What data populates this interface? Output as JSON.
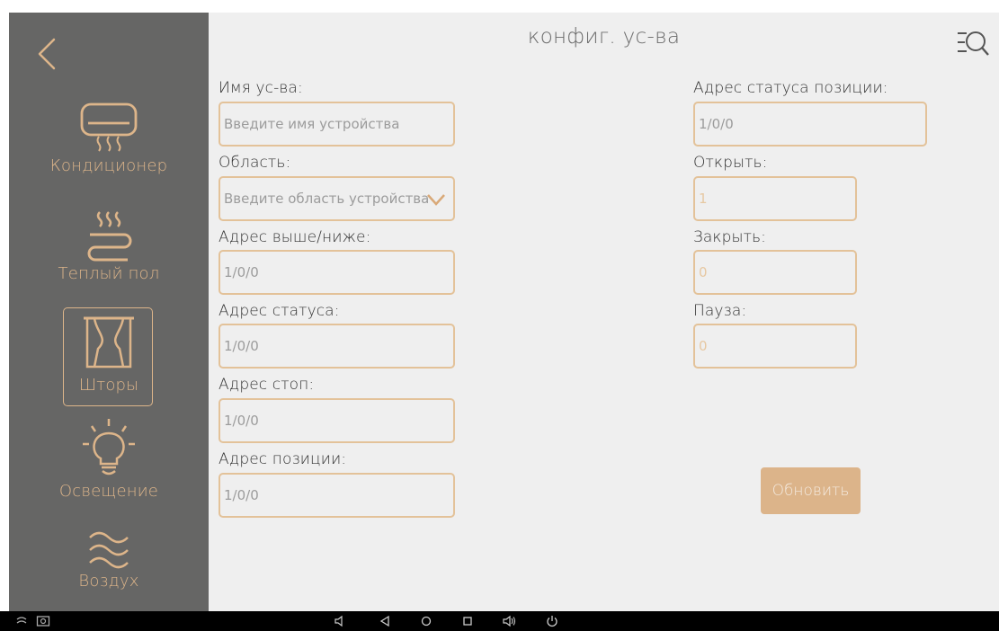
{
  "header": {
    "title": "конфиг. ус-ва"
  },
  "sidebar": {
    "items": [
      {
        "label": "Кондиционер",
        "icon": "air-conditioner-icon"
      },
      {
        "label": "Теплый пол",
        "icon": "floor-heating-icon"
      },
      {
        "label": "Шторы",
        "icon": "curtains-icon",
        "active": true
      },
      {
        "label": "Освещение",
        "icon": "light-bulb-icon"
      },
      {
        "label": "Воздух",
        "icon": "air-waves-icon"
      }
    ]
  },
  "form": {
    "device_name": {
      "label": "Имя ус-ва:",
      "placeholder": "Введите имя устройства"
    },
    "area": {
      "label": "Область:",
      "placeholder": "Введите область устройства"
    },
    "up_down_address": {
      "label": "Адрес выше/ниже:",
      "value": "1/0/0"
    },
    "status_address": {
      "label": "Адрес статуса:",
      "value": "1/0/0"
    },
    "stop_address": {
      "label": "Адрес стоп:",
      "value": "1/0/0"
    },
    "position_address": {
      "label": "Адрес позиции:",
      "value": "1/0/0"
    },
    "position_status_address": {
      "label": "Адрес статуса позиции:",
      "value": "1/0/0"
    },
    "open": {
      "label": "Открыть:",
      "value": "1"
    },
    "close": {
      "label": "Закрыть:",
      "value": "0"
    },
    "pause": {
      "label": "Пауза:",
      "value": "0"
    },
    "update_label": "Обновить"
  },
  "colors": {
    "sidebar_bg": "#666665",
    "accent": "#ddb58a",
    "content_bg": "#efefef",
    "field_border": "#e3c299"
  }
}
